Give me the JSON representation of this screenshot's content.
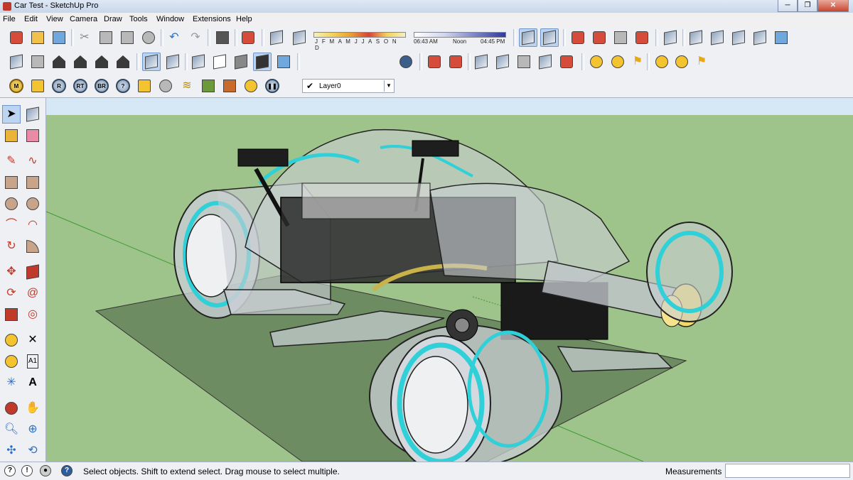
{
  "window": {
    "title": "Car Test - SketchUp Pro"
  },
  "menu": [
    "File",
    "Edit",
    "View",
    "Camera",
    "Draw",
    "Tools",
    "Window",
    "Extensions",
    "Help"
  ],
  "shadows": {
    "months": "J F M A M J J A S O N D",
    "time_start": "06:43 AM",
    "time_mid": "Noon",
    "time_end": "04:45 PM"
  },
  "layer": {
    "current": "Layer0"
  },
  "plugins": [
    "M",
    "R",
    "RT",
    "BR"
  ],
  "status": {
    "message": "Select objects. Shift to extend select. Drag mouse to select multiple.",
    "measurements_label": "Measurements",
    "measurements_value": ""
  },
  "icons": {
    "row1": [
      "get-models-icon",
      "open-icon",
      "save-icon",
      "cut-icon",
      "copy-icon",
      "paste-icon",
      "erase-icon",
      "undo-icon",
      "redo-icon",
      "print-icon",
      "model-info-icon",
      "shadow-toggle-icon",
      "fog-icon"
    ],
    "row2": [
      "iso-view-icon",
      "top-view-icon",
      "front-view-icon",
      "right-view-icon",
      "back-view-icon",
      "left-view-icon",
      "xray-icon",
      "back-edges-icon",
      "wireframe-icon",
      "hidden-line-icon",
      "shaded-icon",
      "shaded-texture-icon"
    ],
    "left": [
      "select-icon",
      "component-icon",
      "paint-icon",
      "eraser-icon",
      "line-icon",
      "freehand-icon",
      "rectangle-icon",
      "rotated-rect-icon",
      "circle-icon",
      "polygon-icon",
      "arc-icon",
      "pie-icon",
      "move-icon",
      "push-pull-icon",
      "rotate-icon",
      "follow-me-icon",
      "scale-icon",
      "offset-icon",
      "tape-icon",
      "dimension-icon",
      "protractor-icon",
      "text-icon",
      "axes-icon",
      "3d-text-icon",
      "orbit-icon",
      "pan-icon",
      "zoom-icon",
      "zoom-window-icon",
      "zoom-extents-icon",
      "previous-view-icon"
    ]
  },
  "colors": {
    "accent_select": "#bcd4f0",
    "ground": "#9ec48b",
    "sky": "#d6e8f5",
    "glow": "#2fd0d8"
  }
}
